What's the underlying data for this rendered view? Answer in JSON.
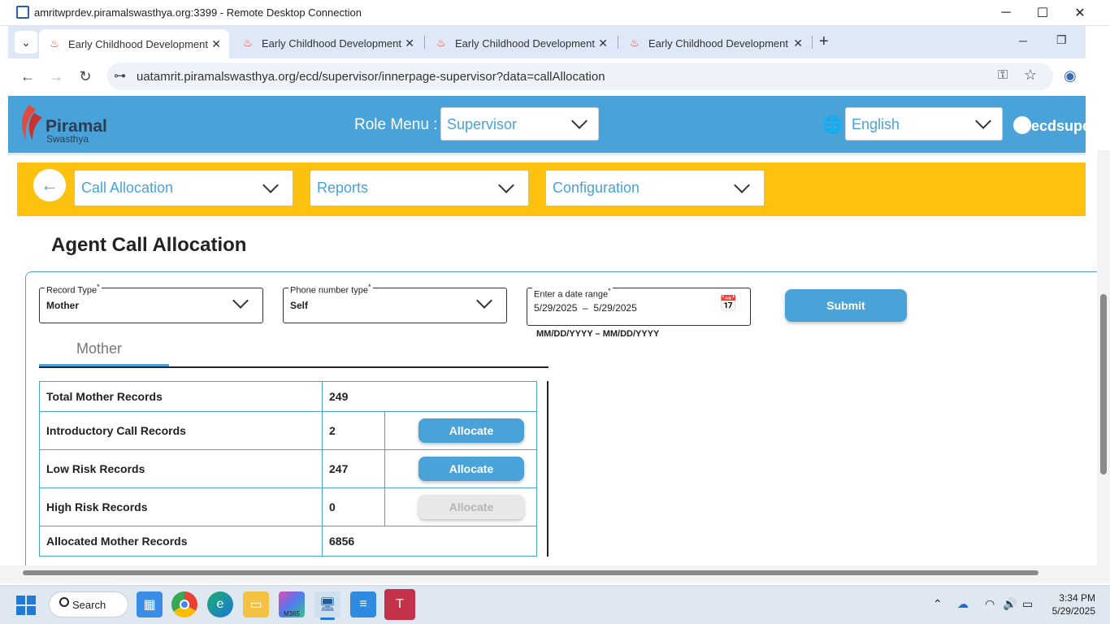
{
  "rdp": {
    "title": "amritwprdev.piramalswasthya.org:3399 - Remote Desktop Connection",
    "minimize": "─",
    "maximize": "☐",
    "close": "✕"
  },
  "browser": {
    "tab_list_button": "⌄",
    "tabs": [
      {
        "label": "Early Childhood Development",
        "close": "✕"
      },
      {
        "label": "Early Childhood Development",
        "close": "✕"
      },
      {
        "label": "Early Childhood Development",
        "close": "✕"
      },
      {
        "label": "Early Childhood Development",
        "close": "✕"
      }
    ],
    "new_tab": "+",
    "url": "uatamrit.piramalswasthya.org/ecd/supervisor/innerpage-supervisor?data=callAllocation",
    "back": "←",
    "forward": "→",
    "reload": "↻",
    "site_info": "⊶",
    "key_icon": "⚿",
    "star_icon": "☆",
    "profile_icon": "◉",
    "win_minimize": "─",
    "win_restore": "❐"
  },
  "header": {
    "logo_name": "Piramal",
    "logo_sub": "Swasthya",
    "role_label": "Role Menu :",
    "role_value": "Supervisor",
    "language_value": "English",
    "globe_icon": "🌐",
    "user_icon": "●",
    "username": "ecdsupe"
  },
  "menu": {
    "back_arrow": "←",
    "items": [
      "Call Allocation",
      "Reports",
      "Configuration"
    ]
  },
  "page": {
    "title": "Agent Call Allocation",
    "record_type_label": "Record Type",
    "record_type_value": "Mother",
    "phone_type_label": "Phone number type",
    "phone_type_value": "Self",
    "date_range_label": "Enter a date range",
    "required_mark": "*",
    "date_range_value": "5/29/2025  –  5/29/2025",
    "date_hint": "MM/DD/YYYY – MM/DD/YYYY",
    "calendar_icon": "📅",
    "submit_label": "Submit",
    "tab_label": "Mother"
  },
  "table": {
    "rows": [
      {
        "label": "Total Mother Records",
        "value": "249"
      },
      {
        "label": "Introductory Call Records",
        "value": "2",
        "action": "Allocate"
      },
      {
        "label": "Low Risk Records",
        "value": "247",
        "action": "Allocate"
      },
      {
        "label": "High Risk Records",
        "value": "0",
        "action": "Allocate"
      },
      {
        "label": "Allocated Mother Records",
        "value": "6856"
      }
    ]
  },
  "taskbar": {
    "search_label": "Search",
    "time": "3:34 PM",
    "date": "5/29/2025",
    "m365_label": "M365",
    "chevron_up": "⌃",
    "wifi_icon": "◠",
    "volume_icon": "🔊",
    "battery_icon": "▭",
    "cloud_icon": "☁"
  }
}
